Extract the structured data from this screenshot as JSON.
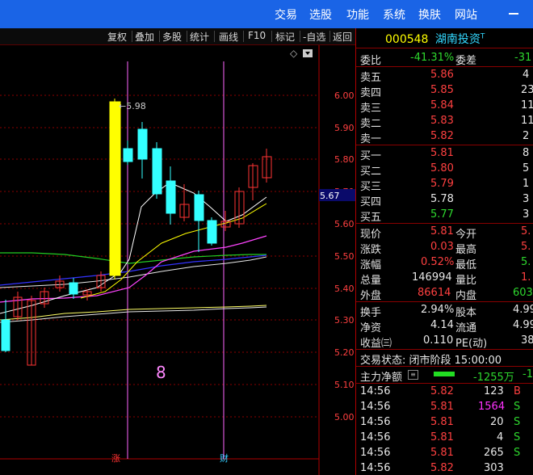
{
  "menu": [
    "交易",
    "选股",
    "功能",
    "系统",
    "换肤",
    "网站"
  ],
  "toolbar": [
    "复权",
    "叠加",
    "多股",
    "统计",
    "画线",
    "F10",
    "标记",
    "-自选",
    "返回"
  ],
  "chart": {
    "price_labels": [
      "6.00",
      "5.90",
      "5.80",
      "5.70",
      "5.60",
      "5.50",
      "5.40",
      "5.30",
      "5.20",
      "5.10",
      "5.00"
    ],
    "current_price_tag": "5.67",
    "high_label": "5.98",
    "big_number": "8",
    "marker1": "涨",
    "marker2": "财",
    "colors": {
      "up": "#ff3333",
      "down": "#33ffff",
      "big": "#ffff00"
    },
    "icons": [
      "diamond-icon",
      "dropdown-icon"
    ]
  },
  "quote": {
    "code": "000548",
    "name": "湖南投资",
    "name_sup": "T",
    "weibi_label": "委比",
    "weibi_value": "-41.31%",
    "weicha_label": "委差",
    "weicha_value": "-31",
    "sell": [
      {
        "label": "卖五",
        "price": "5.86",
        "vol": "4"
      },
      {
        "label": "卖四",
        "price": "5.85",
        "vol": "23"
      },
      {
        "label": "卖三",
        "price": "5.84",
        "vol": "11"
      },
      {
        "label": "卖二",
        "price": "5.83",
        "vol": "11"
      },
      {
        "label": "卖一",
        "price": "5.82",
        "vol": "2"
      }
    ],
    "buy": [
      {
        "label": "买一",
        "price": "5.81",
        "vol": "8"
      },
      {
        "label": "买二",
        "price": "5.80",
        "vol": "5"
      },
      {
        "label": "买三",
        "price": "5.79",
        "vol": "1"
      },
      {
        "label": "买四",
        "price": "5.78",
        "vol": "3"
      },
      {
        "label": "买五",
        "price": "5.77",
        "vol": "3"
      }
    ],
    "stats": [
      {
        "l1": "现价",
        "v1": "5.81",
        "l2": "今开",
        "v2": "5."
      },
      {
        "l1": "涨跌",
        "v1": "0.03",
        "l2": "最高",
        "v2": "5."
      },
      {
        "l1": "涨幅",
        "v1": "0.52%",
        "l2": "最低",
        "v2": "5."
      },
      {
        "l1": "总量",
        "v1": "146994",
        "l2": "量比",
        "v2": "1."
      },
      {
        "l1": "外盘",
        "v1": "86614",
        "l2": "内盘",
        "v2": "603"
      }
    ],
    "stats2": [
      {
        "l1": "换手",
        "v1": "2.94%",
        "l2": "股本",
        "v2": "4.99"
      },
      {
        "l1": "净资",
        "v1": "4.14",
        "l2": "流通",
        "v2": "4.99"
      },
      {
        "l1": "收益㈢",
        "v1": "0.110",
        "l2": "PE(动)",
        "v2": "38"
      }
    ],
    "trade_status": "交易状态: 闭市阶段 15:00:00",
    "net_label": "主力净额",
    "net_value": "-1255万",
    "net_value2": "-1"
  },
  "ticks": [
    {
      "time": "14:56",
      "price": "5.82",
      "vol": "123",
      "bs": "B"
    },
    {
      "time": "14:56",
      "price": "5.81",
      "vol": "1564",
      "bs": "S"
    },
    {
      "time": "14:56",
      "price": "5.81",
      "vol": "20",
      "bs": "S"
    },
    {
      "time": "14:56",
      "price": "5.81",
      "vol": "4",
      "bs": "S"
    },
    {
      "time": "14:56",
      "price": "5.81",
      "vol": "265",
      "bs": "S"
    },
    {
      "time": "14:56",
      "price": "5.82",
      "vol": "303",
      "bs": ""
    }
  ]
}
